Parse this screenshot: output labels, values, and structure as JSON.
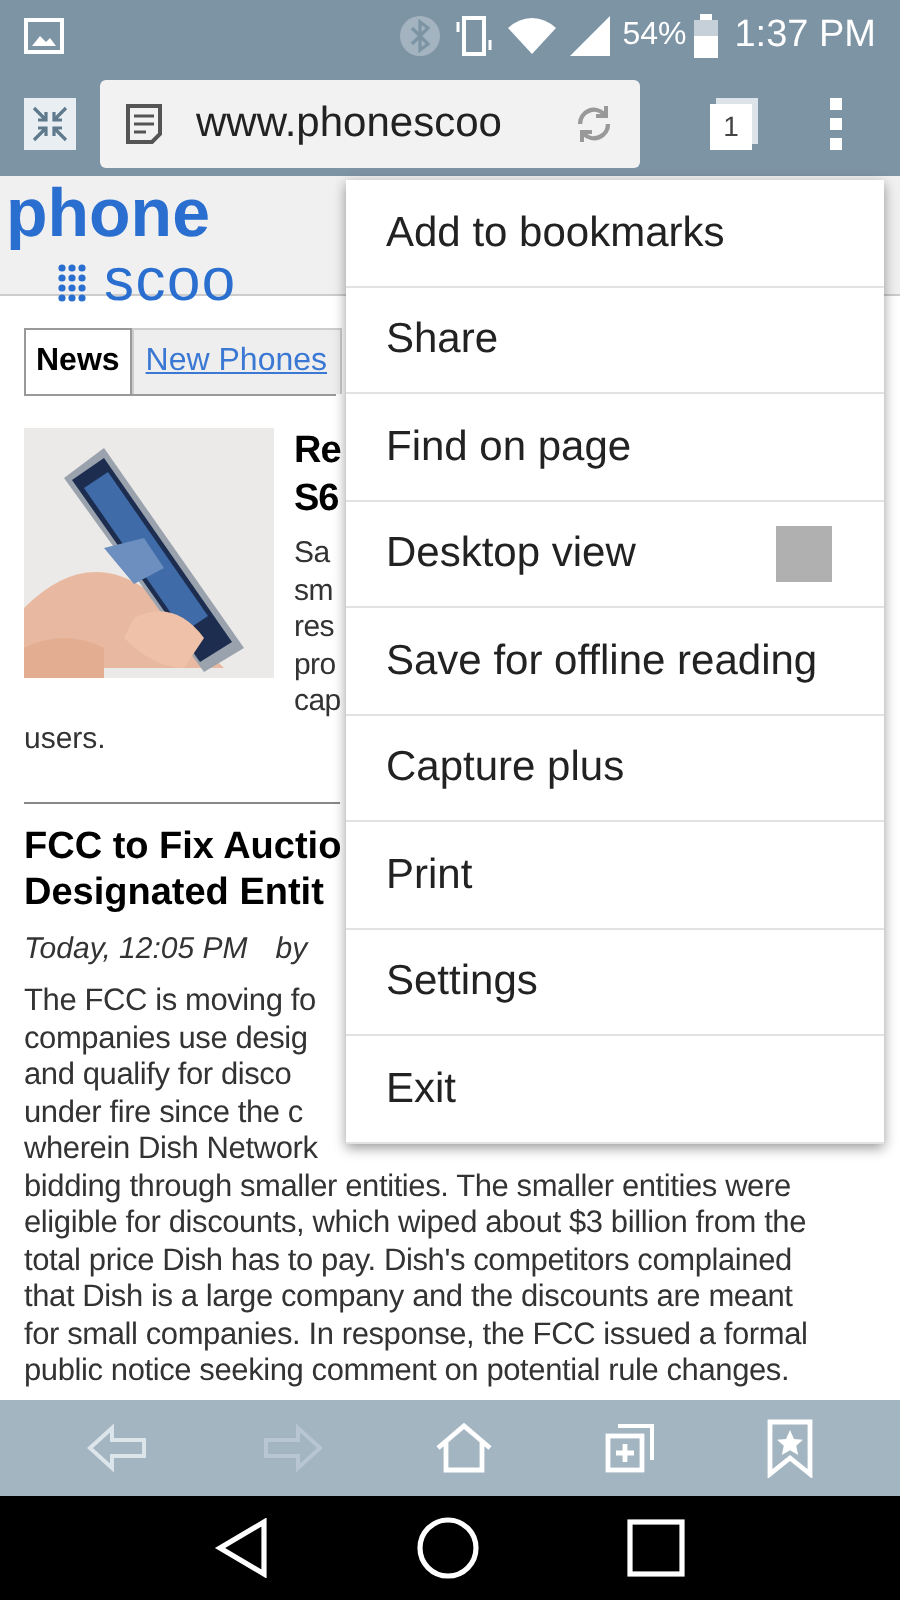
{
  "status_bar": {
    "battery": "54%",
    "time": "1:37 PM"
  },
  "address_bar": {
    "url": "www.phonescoo",
    "tab_count": "1"
  },
  "page": {
    "logo": [
      "phone",
      "scoo"
    ],
    "tabs": [
      {
        "label": "News",
        "selected": true
      },
      {
        "label": "New Phones",
        "selected": false
      }
    ],
    "featured": {
      "title_lines": [
        "Re",
        "S6"
      ],
      "summary_lines": [
        "Sa",
        "sm",
        "res",
        "pro",
        "cap"
      ],
      "tail": "users."
    },
    "article": {
      "headline_lines": [
        "FCC to Fix Auctio",
        "Designated Entit"
      ],
      "date": "Today, 12:05 PM",
      "by": "by",
      "body_lines": [
        "The FCC is moving fo",
        "companies use desig",
        "and qualify for disco",
        "under fire since the c",
        "wherein Dish Network",
        "bidding through smaller entities. The smaller entities were",
        "eligible for discounts, which wiped about $3 billion from the",
        "total price Dish has to pay. Dish's competitors complained",
        "that Dish is a large company and the discounts are meant",
        "for small companies. In response, the FCC issued a formal",
        "public notice seeking comment on potential rule changes."
      ]
    }
  },
  "menu": {
    "items": [
      {
        "label": "Add to bookmarks",
        "kind": "plain"
      },
      {
        "label": "Share",
        "kind": "plain"
      },
      {
        "label": "Find on page",
        "kind": "plain"
      },
      {
        "label": "Desktop view",
        "kind": "checkbox",
        "checked": false
      },
      {
        "label": "Save for offline reading",
        "kind": "plain"
      },
      {
        "label": "Capture plus",
        "kind": "plain"
      },
      {
        "label": "Print",
        "kind": "plain"
      },
      {
        "label": "Settings",
        "kind": "plain"
      },
      {
        "label": "Exit",
        "kind": "plain"
      }
    ]
  }
}
